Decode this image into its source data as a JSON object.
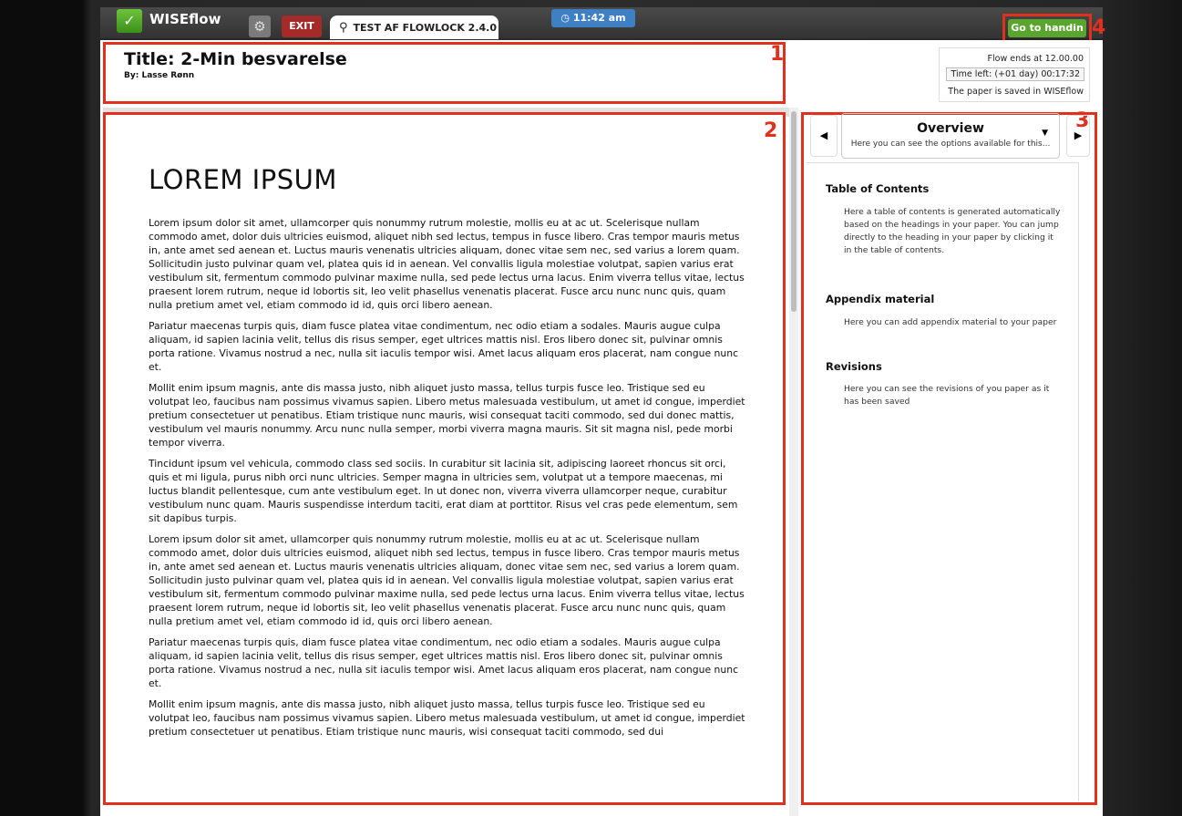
{
  "topbar": {
    "brand": "WISEflow",
    "exit_label": "EXIT",
    "flow_tab_label": "TEST AF FLOWLOCK 2.4.0",
    "clock": "11:42 am",
    "handin_label": "Go to handin"
  },
  "header": {
    "title": "Title: 2-Min besvarelse",
    "byline": "By: Lasse Rønn"
  },
  "flow_info": {
    "ends": "Flow ends at 12.00.00",
    "time_left": "Time left: (+01 day) 00:17:32",
    "saved": "The paper is saved in WISEflow"
  },
  "document": {
    "heading": "LOREM IPSUM",
    "paragraphs": [
      "Lorem ipsum dolor sit amet, ullamcorper quis nonummy rutrum molestie, mollis eu at ac ut. Scelerisque nullam commodo amet, dolor duis ultricies euismod, aliquet nibh sed lectus, tempus in fusce libero. Cras tempor mauris metus in, ante amet sed aenean et. Luctus mauris venenatis ultricies aliquam, donec vitae sem nec, sed varius a lorem quam. Sollicitudin justo pulvinar quam vel, platea quis id in aenean. Vel convallis ligula molestiae volutpat, sapien varius erat vestibulum sit, fermentum commodo pulvinar maxime nulla, sed pede lectus urna lacus. Enim viverra tellus vitae, lectus praesent lorem rutrum, neque id lobortis sit, leo velit phasellus venenatis placerat. Fusce arcu nunc nunc quis, quam nulla pretium amet vel, etiam commodo id id, quis orci libero aenean.",
      "Pariatur maecenas turpis quis, diam fusce platea vitae condimentum, nec odio etiam a sodales. Mauris augue culpa aliquam, id sapien lacinia velit, tellus dis risus semper, eget ultrices mattis nisl. Eros libero donec sit, pulvinar omnis porta ratione. Vivamus nostrud a nec, nulla sit iaculis tempor wisi. Amet lacus aliquam eros placerat, nam congue nunc et.",
      "Mollit enim ipsum magnis, ante dis massa justo, nibh aliquet justo massa, tellus turpis fusce leo. Tristique sed eu volutpat leo, faucibus nam possimus vivamus sapien. Libero metus malesuada vestibulum, ut amet id congue, imperdiet pretium consectetuer ut penatibus. Etiam tristique nunc mauris, wisi consequat taciti commodo, sed dui donec mattis, vestibulum vel mauris nonummy. Arcu nunc nulla semper, morbi viverra magna mauris. Sit sit magna nisl, pede morbi tempor viverra.",
      "Tincidunt ipsum vel vehicula, commodo class sed sociis. In curabitur sit lacinia sit, adipiscing laoreet rhoncus sit orci, quis et mi ligula, purus nibh orci nunc ultricies. Semper magna in ultricies sem, volutpat ut a tempore maecenas, mi luctus blandit pellentesque, cum ante vestibulum eget. In ut donec non, viverra viverra ullamcorper neque, curabitur vestibulum nunc quam. Mauris suspendisse interdum taciti, erat diam at porttitor. Risus vel cras pede elementum, sem sit dapibus turpis.",
      "Lorem ipsum dolor sit amet, ullamcorper quis nonummy rutrum molestie, mollis eu at ac ut. Scelerisque nullam commodo amet, dolor duis ultricies euismod, aliquet nibh sed lectus, tempus in fusce libero. Cras tempor mauris metus in, ante amet sed aenean et. Luctus mauris venenatis ultricies aliquam, donec vitae sem nec, sed varius a lorem quam. Sollicitudin justo pulvinar quam vel, platea quis id in aenean. Vel convallis ligula molestiae volutpat, sapien varius erat vestibulum sit, fermentum commodo pulvinar maxime nulla, sed pede lectus urna lacus. Enim viverra tellus vitae, lectus praesent lorem rutrum, neque id lobortis sit, leo velit phasellus venenatis placerat. Fusce arcu nunc nunc quis, quam nulla pretium amet vel, etiam commodo id id, quis orci libero aenean.",
      "Pariatur maecenas turpis quis, diam fusce platea vitae condimentum, nec odio etiam a sodales. Mauris augue culpa aliquam, id sapien lacinia velit, tellus dis risus semper, eget ultrices mattis nisl. Eros libero donec sit, pulvinar omnis porta ratione. Vivamus nostrud a nec, nulla sit iaculis tempor wisi. Amet lacus aliquam eros placerat, nam congue nunc et.",
      "Mollit enim ipsum magnis, ante dis massa justo, nibh aliquet justo massa, tellus turpis fusce leo. Tristique sed eu volutpat leo, faucibus nam possimus vivamus sapien. Libero metus malesuada vestibulum, ut amet id congue, imperdiet pretium consectetuer ut penatibus. Etiam tristique nunc mauris, wisi consequat taciti commodo, sed dui"
    ]
  },
  "side_panel": {
    "overview_title": "Overview",
    "overview_subtitle": "Here you can see the options available for this...",
    "sections": [
      {
        "title": "Table of Contents",
        "text": "Here a table of contents is generated automatically based on the headings in your paper. You can jump directly to the heading in your paper by clicking it in the table of contents."
      },
      {
        "title": "Appendix material",
        "text": "Here you can add appendix material to your paper"
      },
      {
        "title": "Revisions",
        "text": "Here you can see the revisions of you paper as it has been saved"
      }
    ]
  },
  "callouts": [
    "1",
    "2",
    "3",
    "4"
  ],
  "icons": {
    "logo": "wiseflow-logo-icon",
    "gear": "gear-icon",
    "flow": "flowlock-icon",
    "clock": "clock-icon"
  },
  "colors": {
    "accent_red": "#e0301e",
    "handin_green": "#5aa52e",
    "exit_red": "#a52a2a",
    "clock_blue": "#3f7fc4"
  }
}
